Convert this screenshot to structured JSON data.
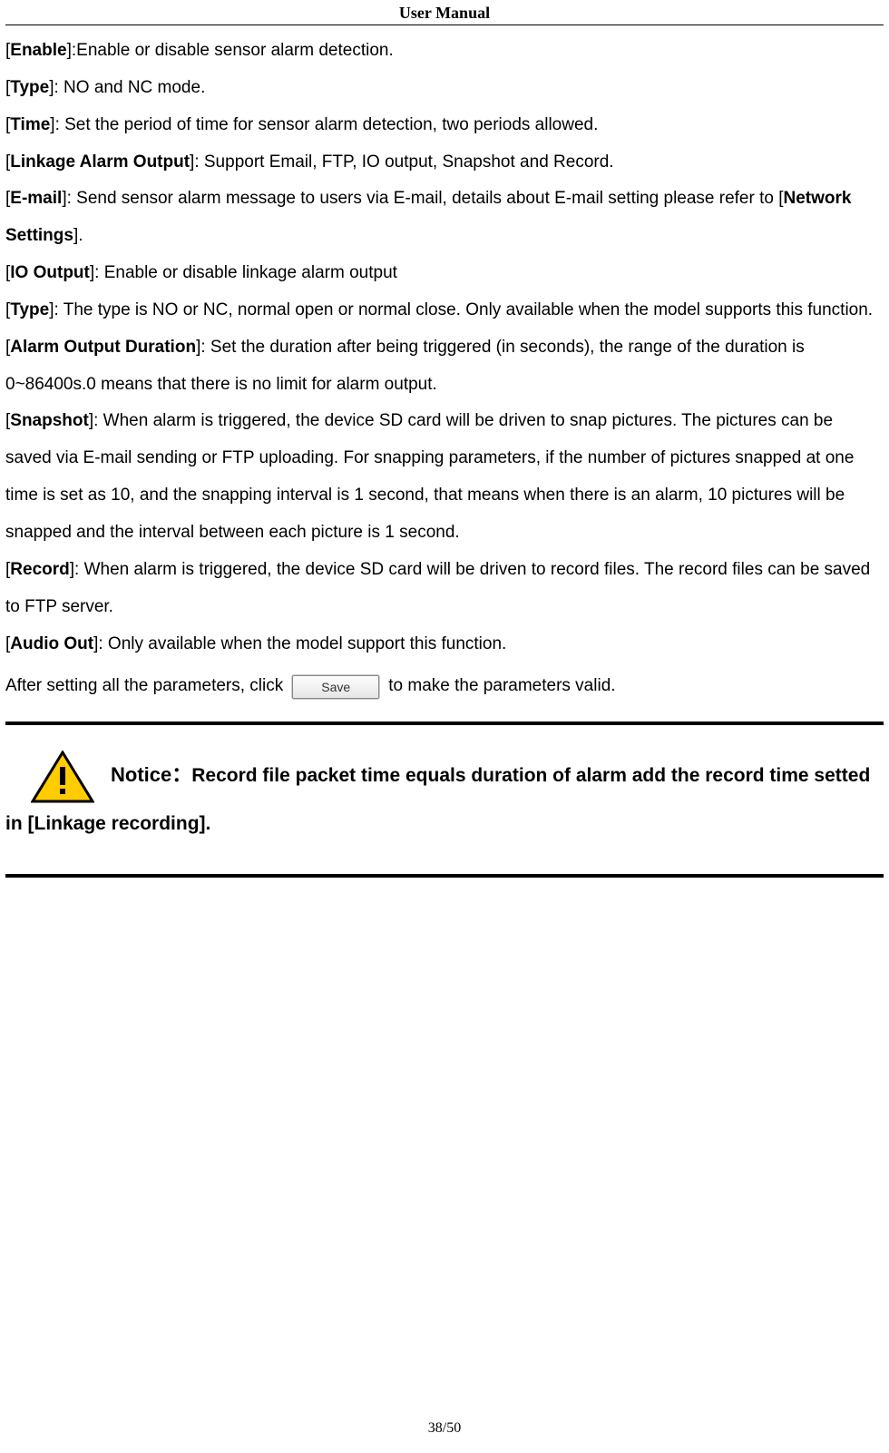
{
  "header": {
    "title": "User Manual"
  },
  "items": {
    "enable": {
      "label": "Enable",
      "text": ":Enable or disable sensor alarm detection."
    },
    "type1": {
      "label": "Type",
      "text": ": NO and NC mode."
    },
    "time": {
      "label": "Time",
      "text": ": Set the period of time for sensor alarm detection, two periods allowed."
    },
    "linkage": {
      "label": "Linkage Alarm Output",
      "text": ": Support Email, FTP, IO output, Snapshot and Record."
    },
    "email": {
      "label": "E-mail",
      "text_before": ": Send sensor alarm message to users via E-mail, details about E-mail setting please refer to [",
      "ref": "Network Settings",
      "text_after": "]."
    },
    "io_output": {
      "label": "IO Output",
      "text": ": Enable or disable linkage alarm output"
    },
    "type2": {
      "label": "Type",
      "text": ": The type is NO or NC, normal open or normal close. Only available when the model supports this function."
    },
    "alarm_duration": {
      "label": "Alarm Output Duration",
      "text": ": Set the duration after being triggered (in seconds), the range of the duration is 0~86400s.0 means that there is no limit for alarm output."
    },
    "snapshot": {
      "label": "Snapshot",
      "text": ": When alarm is triggered, the device SD card will be driven to snap pictures. The pictures can be saved via E-mail sending or FTP uploading. For snapping parameters, if the number of pictures snapped at one time is set as 10, and the snapping interval is 1 second, that means when there is an alarm, 10 pictures will be snapped and the interval between each picture is 1 second."
    },
    "record": {
      "label": "Record",
      "text": ": When alarm is triggered, the device SD card will be driven to record files. The record files can be saved to FTP server."
    },
    "audio_out": {
      "label": "Audio Out",
      "text": ": Only available when the model support this function."
    }
  },
  "save_line": {
    "before": "After setting all the parameters, click",
    "button_label": "Save",
    "after": "to make the parameters valid."
  },
  "notice": {
    "label": "Notice：",
    "text": "Record file packet time equals duration of alarm add the record time setted in [Linkage recording]."
  },
  "footer": {
    "page": "38/50"
  }
}
